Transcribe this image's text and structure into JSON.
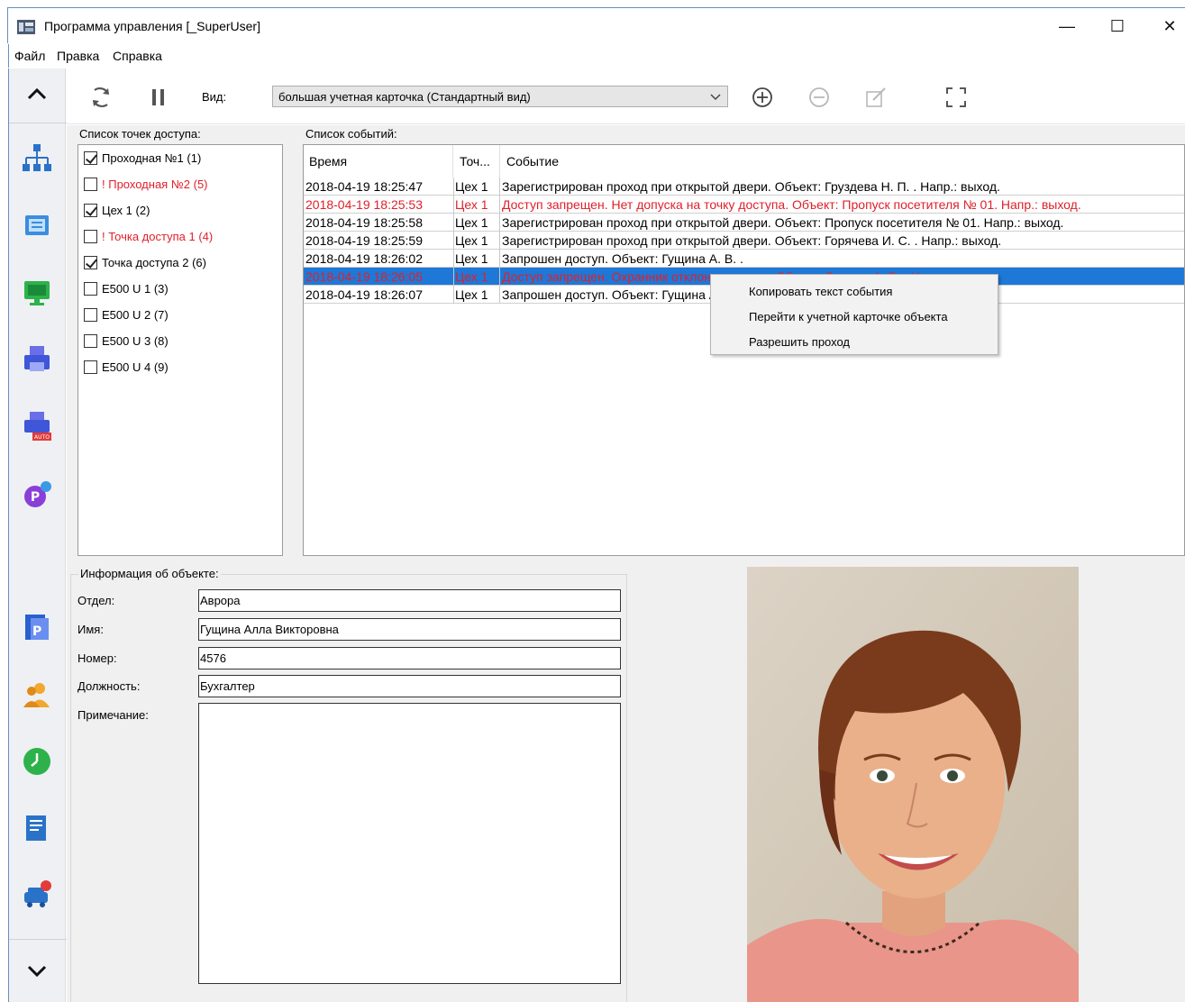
{
  "window": {
    "title": "Программа управления [_SuperUser]",
    "controls": {
      "minimize": "—",
      "maximize": "☐",
      "close": "✕"
    }
  },
  "menu": {
    "items": [
      "Файл",
      "Правка",
      "Справка"
    ]
  },
  "sidebar": {
    "icons": [
      "org-structure-icon",
      "card-terminal-icon",
      "monitor-icon",
      "printer-icon",
      "auto-printer-icon",
      "parking-icon",
      "document-p-icon",
      "users-icon",
      "clock-icon",
      "report-icon",
      "car-alert-icon"
    ],
    "up_icon": "chevron-up-icon",
    "down_icon": "chevron-down-icon"
  },
  "toolbar": {
    "view_label": "Вид:",
    "view_value": "большая учетная карточка (Стандартный вид)",
    "icons": [
      "refresh-icon",
      "pause-icon",
      "add-icon",
      "remove-icon",
      "edit-icon",
      "fullscreen-icon"
    ]
  },
  "access_points": {
    "label": "Список точек доступа:",
    "items": [
      {
        "label": "Проходная №1 (1)",
        "checked": true,
        "alert": false
      },
      {
        "label": "! Проходная №2 (5)",
        "checked": false,
        "alert": true
      },
      {
        "label": "Цех 1 (2)",
        "checked": true,
        "alert": false
      },
      {
        "label": "! Точка доступа 1 (4)",
        "checked": false,
        "alert": true
      },
      {
        "label": "Точка доступа 2 (6)",
        "checked": true,
        "alert": false
      },
      {
        "label": "E500 U 1 (3)",
        "checked": false,
        "alert": false
      },
      {
        "label": "E500 U 2 (7)",
        "checked": false,
        "alert": false
      },
      {
        "label": "E500 U 3 (8)",
        "checked": false,
        "alert": false
      },
      {
        "label": "E500 U 4 (9)",
        "checked": false,
        "alert": false
      }
    ]
  },
  "events": {
    "label": "Список событий:",
    "columns": [
      "Время",
      "Точ...",
      "Событие"
    ],
    "rows": [
      {
        "time": "2018-04-19 18:25:47",
        "point": "Цех 1",
        "event": "Зарегистрирован проход при открытой двери. Объект: Груздева Н. П. . Напр.: выход.",
        "style": "normal"
      },
      {
        "time": "2018-04-19 18:25:53",
        "point": "Цех 1",
        "event": "Доступ запрещен. Нет допуска на точку доступа. Объект: Пропуск посетителя № 01. Напр.: выход.",
        "style": "red"
      },
      {
        "time": "2018-04-19 18:25:58",
        "point": "Цех 1",
        "event": "Зарегистрирован проход при открытой двери. Объект: Пропуск посетителя № 01. Напр.: выход.",
        "style": "normal"
      },
      {
        "time": "2018-04-19 18:25:59",
        "point": "Цех 1",
        "event": "Зарегистрирован проход при открытой двери. Объект: Горячева И. С. . Напр.: выход.",
        "style": "normal"
      },
      {
        "time": "2018-04-19 18:26:02",
        "point": "Цех 1",
        "event": "Запрошен доступ. Объект: Гущина А. В. .",
        "style": "normal"
      },
      {
        "time": "2018-04-19 18:26:05",
        "point": "Цех 1",
        "event": "Доступ запрещен. Охранник отклонил доступ. Объект: Гущина А. В. . Напр.: выход.",
        "style": "selected"
      },
      {
        "time": "2018-04-19 18:26:07",
        "point": "Цех 1",
        "event": "Запрошен доступ. Объект: Гущина А. В. .",
        "style": "normal"
      }
    ]
  },
  "context_menu": {
    "items": [
      "Копировать текст события",
      "Перейти к учетной карточке объекта",
      "Разрешить проход"
    ]
  },
  "object_info": {
    "legend": "Информация об объекте:",
    "labels": {
      "department": "Отдел:",
      "name": "Имя:",
      "number": "Номер:",
      "position": "Должность:",
      "note": "Примечание:"
    },
    "values": {
      "department": "Аврора",
      "name": "Гущина Алла Викторовна",
      "number": "4576",
      "position": "Бухгалтер",
      "note": ""
    }
  },
  "colors": {
    "alert_red": "#e0202a",
    "selection_blue": "#1e78d7"
  }
}
